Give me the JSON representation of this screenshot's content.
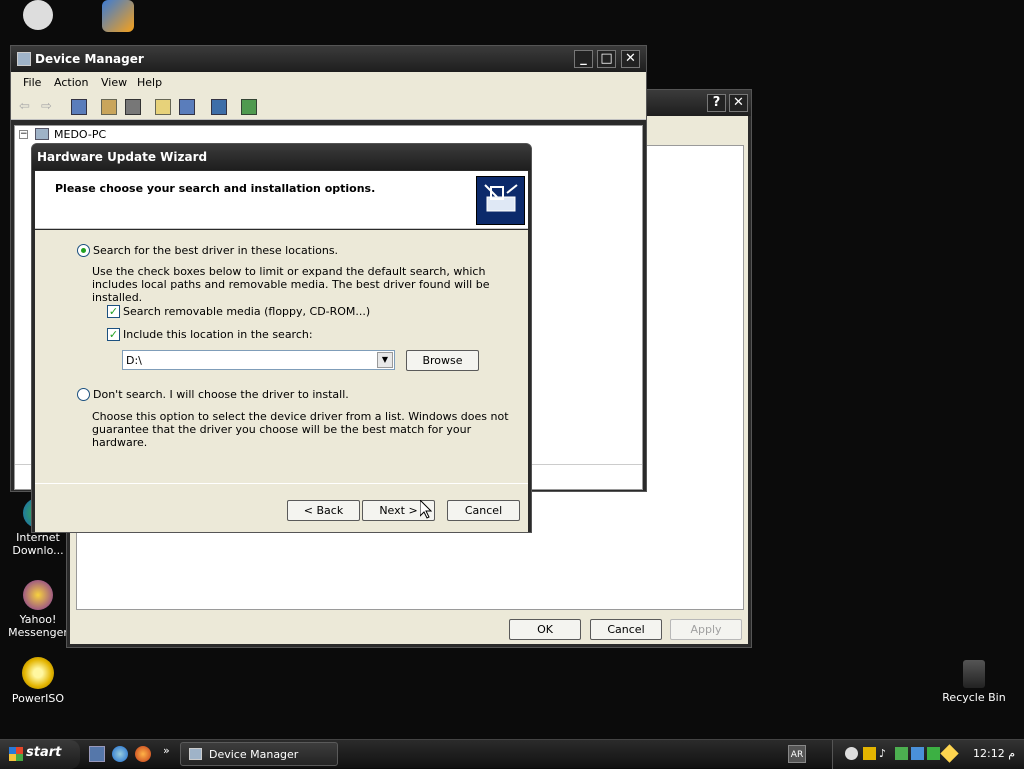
{
  "desktop": {
    "icons": [
      {
        "label": "Internet Downlo..."
      },
      {
        "label": "Yahoo! Messenger"
      },
      {
        "label": "PowerISO"
      },
      {
        "label": "Recycle Bin"
      }
    ]
  },
  "device_manager": {
    "title": "Device Manager",
    "menu": [
      "File",
      "Action",
      "View",
      "Help"
    ],
    "tree_root": "MEDO-PC"
  },
  "properties_dialog": {
    "help_button": "?",
    "close_button": "✕",
    "ok": "OK",
    "cancel": "Cancel",
    "apply": "Apply"
  },
  "wizard": {
    "title": "Hardware Update Wizard",
    "header": "Please choose your search and installation options.",
    "option_search": {
      "label": "Search for the best driver in these locations.",
      "selected": true,
      "description": "Use the check boxes below to limit or expand the default search, which includes local paths and removable media. The best driver found will be installed."
    },
    "check_removable": {
      "label": "Search removable media (floppy, CD-ROM...)",
      "checked": true
    },
    "check_location": {
      "label": "Include this location in the search:",
      "checked": true
    },
    "location_value": "D:\\",
    "browse": "Browse",
    "option_manual": {
      "label": "Don't search. I will choose the driver to install.",
      "selected": false,
      "description": "Choose this option to select the device driver from a list.  Windows does not guarantee that the driver you choose will be the best match for your hardware."
    },
    "back": "< Back",
    "next": "Next >",
    "cancel": "Cancel"
  },
  "taskbar": {
    "start": "start",
    "task": "Device Manager",
    "language": "AR",
    "clock": "12:12 م"
  },
  "colors": {
    "desktop": "#0b0b0b",
    "dialog_face": "#ece9d8",
    "titlebar": "#2a2a2a",
    "radio_dot": "#21a121"
  }
}
